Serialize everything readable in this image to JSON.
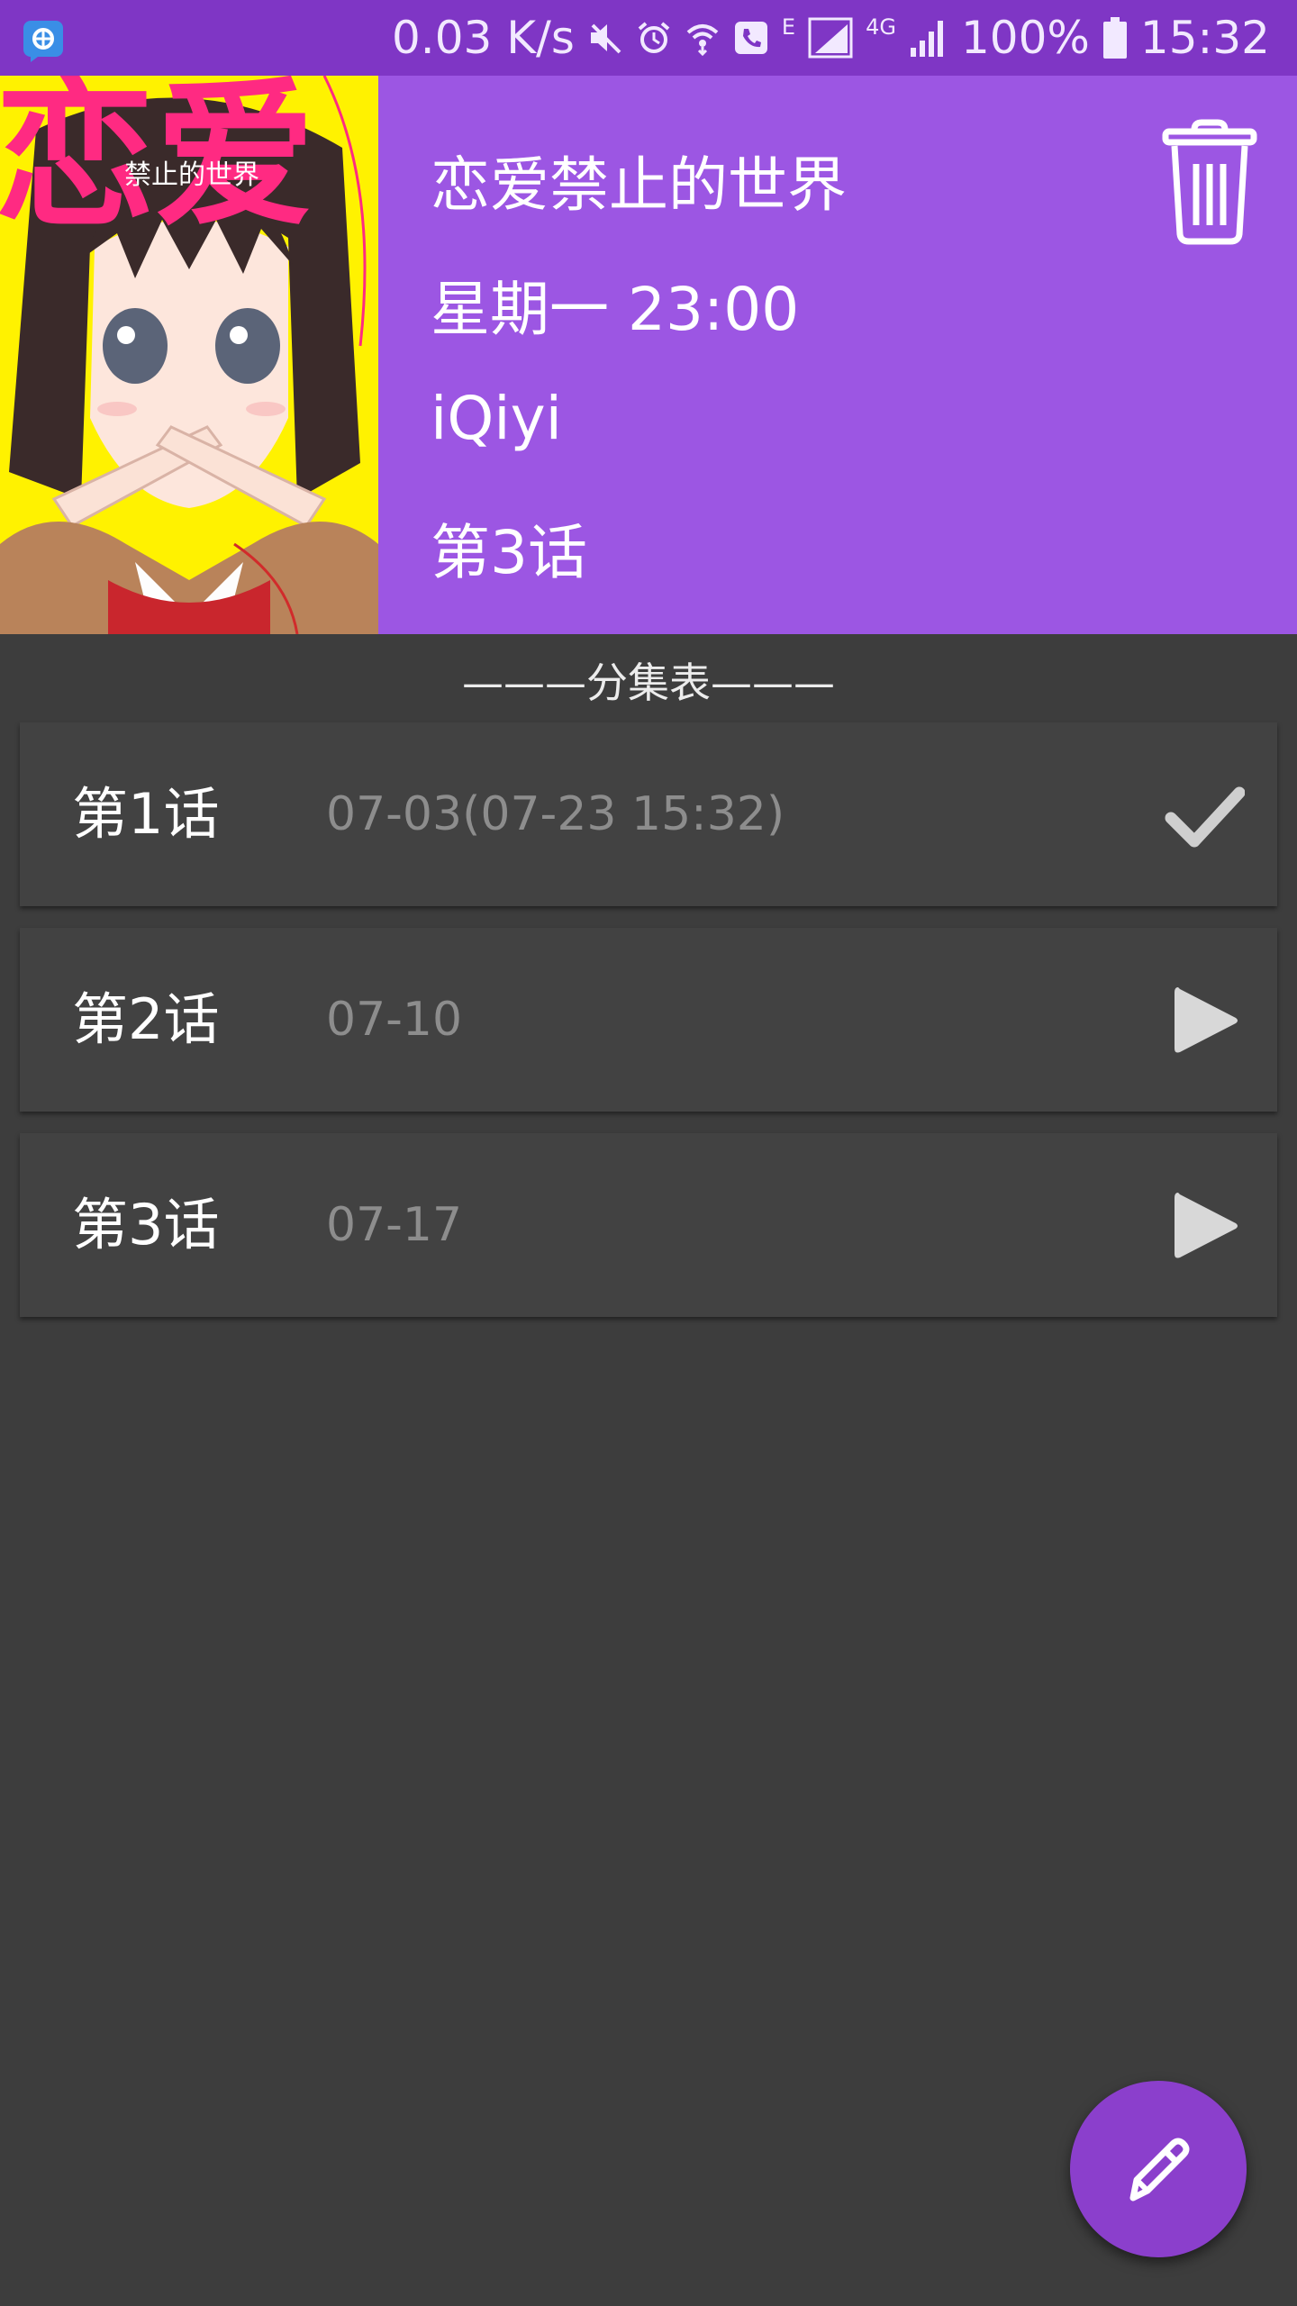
{
  "colors": {
    "status_bar": "#7f36c5",
    "header": "#9c56e3",
    "background": "#3d3d3d",
    "card": "#424242",
    "fab": "#8b3fcc",
    "date_text": "#8d8d8d"
  },
  "status_bar": {
    "net_speed": "0.03 K/s",
    "network_e": "E",
    "network_4g": "4G",
    "battery": "100%",
    "time": "15:32",
    "icons": [
      "app-notification-icon",
      "mute-icon",
      "alarm-icon",
      "wifi-call-icon",
      "call-icon",
      "signal-icon",
      "signal-icon",
      "battery-icon"
    ]
  },
  "header": {
    "cover_title": "恋爱",
    "cover_subtitle": "禁止的世界",
    "title": "恋爱禁止的世界",
    "schedule": "星期一 23:00",
    "platform": "iQiyi",
    "progress": "第3话",
    "delete_icon": "trash-icon"
  },
  "episodes_section": {
    "title": "———分集表———",
    "items": [
      {
        "title": "第1话",
        "date": "07-03(07-23 15:32)",
        "status": "watched",
        "icon": "check-icon"
      },
      {
        "title": "第2话",
        "date": "07-10",
        "status": "unwatched",
        "icon": "play-icon"
      },
      {
        "title": "第3话",
        "date": "07-17",
        "status": "unwatched",
        "icon": "play-icon"
      }
    ]
  },
  "fab": {
    "icon": "edit-pencil-icon"
  }
}
